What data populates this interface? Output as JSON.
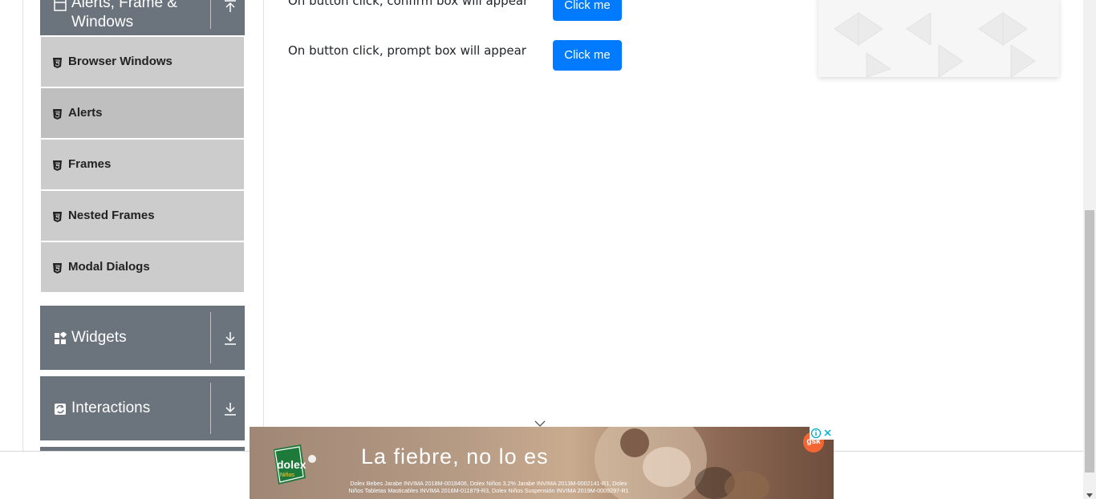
{
  "sidebar": {
    "alerts_group": {
      "title": "Alerts, Frame & Windows",
      "icon": "window-icon",
      "arrow": "collapse-up-icon"
    },
    "items": [
      {
        "label": "Browser Windows",
        "icon": "html5-icon"
      },
      {
        "label": "Alerts",
        "icon": "html5-icon"
      },
      {
        "label": "Frames",
        "icon": "html5-icon"
      },
      {
        "label": "Nested Frames",
        "icon": "html5-icon"
      },
      {
        "label": "Modal Dialogs",
        "icon": "html5-icon"
      }
    ],
    "widgets_group": {
      "title": "Widgets",
      "icon": "widgets-icon",
      "arrow": "expand-down-icon"
    },
    "interactions_group": {
      "title": "Interactions",
      "icon": "interactions-icon",
      "arrow": "expand-down-icon"
    }
  },
  "main": {
    "rows": [
      {
        "text": "On button click, confirm box will appear",
        "button": "Click me"
      },
      {
        "text": "On button click, prompt box will appear",
        "button": "Click me"
      }
    ]
  },
  "ad": {
    "brand": "dolex",
    "brand_sub": "Niños",
    "headline": "La fiebre, no lo es",
    "legal_line1": "Dolex Bebes Jarabe INVIMA 2018M-0018406, Dolex Niños 3.2% Jarabe INVIMA 2013M-0002141-R1, Dolex",
    "legal_line2": "Niños Tabletas Masticables INVIMA 2016M-011879-R3, Dolex Niños Suspensión INVIMA 2019M-0009297-R1",
    "sponsor": "gsk"
  },
  "colors": {
    "primary_button": "#007bff",
    "group_header": "#6b737c",
    "menu_item": "#cccccc",
    "menu_item_active": "#bfbfbf"
  }
}
